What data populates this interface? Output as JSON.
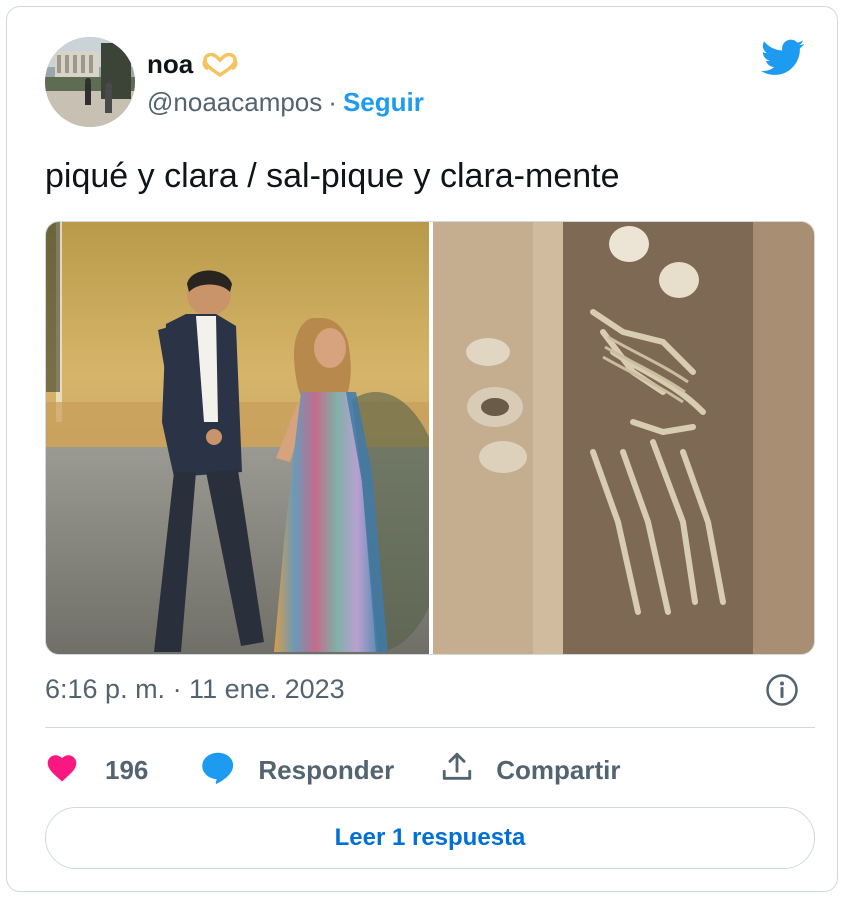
{
  "user": {
    "display_name": "noa",
    "handle": "@noaacampos",
    "separator": "·",
    "follow_label": "Seguir"
  },
  "tweet": {
    "text": "piqué y clara / sal-pique y clara-mente",
    "timestamp": "6:16 p. m. · 11 ene. 2023"
  },
  "actions": {
    "likes": "196",
    "reply_label": "Responder",
    "share_label": "Compartir"
  },
  "read_replies_label": "Leer 1 respuesta",
  "colors": {
    "brand_blue": "#1d9bf0",
    "link_blue": "#006fd6",
    "like_pink": "#f91880",
    "muted_text": "#536471",
    "border": "#cfd9de"
  },
  "icons": [
    "heart-hands-emoji",
    "twitter-bird-icon",
    "info-icon",
    "heart-icon",
    "reply-bubble-icon",
    "share-icon"
  ]
}
